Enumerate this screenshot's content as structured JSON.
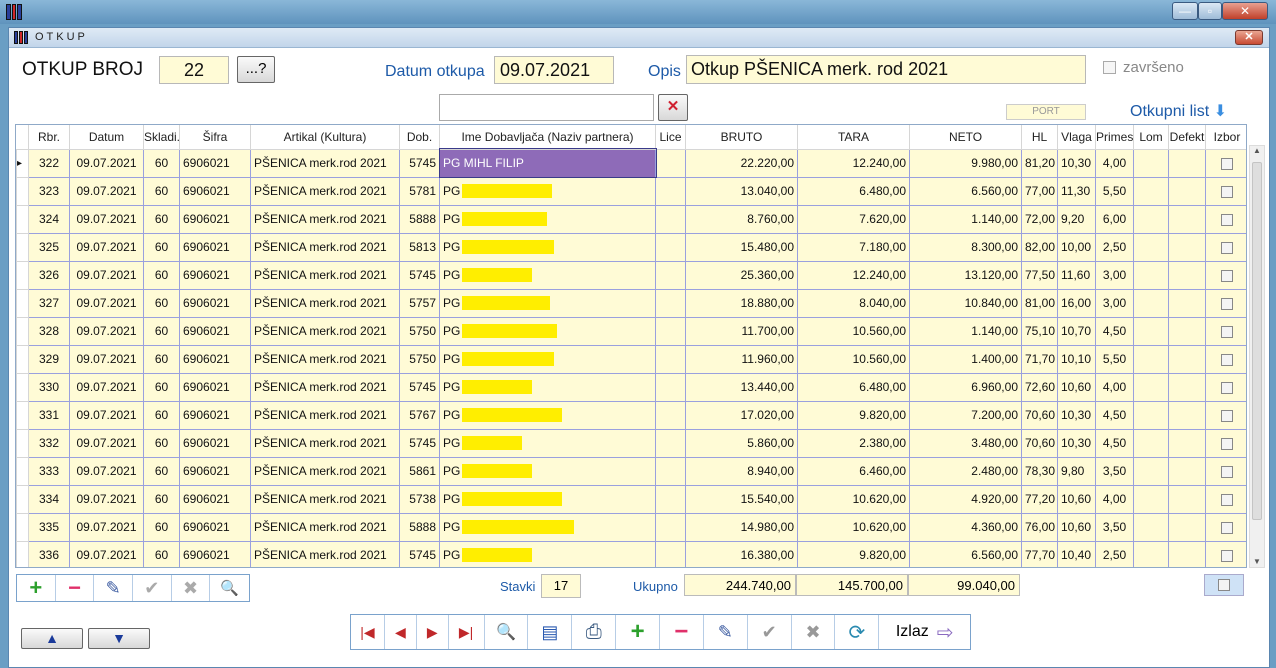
{
  "window": {
    "minimize": "—",
    "restore": "▫",
    "close": "✕"
  },
  "form": {
    "title": "OTKUP",
    "close": "✕",
    "otkup_broj_label": "OTKUP BROJ",
    "otkup_broj": "22",
    "browse_label": "...?",
    "datum_label": "Datum otkupa",
    "datum": "09.07.2021",
    "opis_label": "Opis",
    "opis": "Otkup PŠENICA merk. rod 2021",
    "zavrseno_label": "završeno",
    "port_label": "PORT",
    "otkupni_list_label": "Otkupni list",
    "search_value": "",
    "clear_icon": "✕"
  },
  "grid": {
    "columns": [
      "Rbr.",
      "Datum",
      "Skladi.",
      "Šifra",
      "Artikal (Kultura)",
      "Dob.",
      "Ime Dobavljača (Naziv partnera)",
      "Lice",
      "BRUTO",
      "TARA",
      "NETO",
      "HL",
      "Vlaga",
      "Primes",
      "Lom",
      "Defekt",
      "Izbor"
    ],
    "rows": [
      {
        "rbr": "322",
        "datum": "09.07.2021",
        "skl": "60",
        "sifra": "6906021",
        "artikal": "PŠENICA merk.rod 2021",
        "dob": "5745",
        "ime": "PG MIHL FILIP",
        "bruto": "22.220,00",
        "tara": "12.240,00",
        "neto": "9.980,00",
        "hl": "81,20",
        "vlaga": "10,30",
        "primes": "4,00"
      },
      {
        "rbr": "323",
        "datum": "09.07.2021",
        "skl": "60",
        "sifra": "6906021",
        "artikal": "PŠENICA merk.rod 2021",
        "dob": "5781",
        "ime": "PG",
        "bruto": "13.040,00",
        "tara": "6.480,00",
        "neto": "6.560,00",
        "hl": "77,00",
        "vlaga": "11,30",
        "primes": "5,50"
      },
      {
        "rbr": "324",
        "datum": "09.07.2021",
        "skl": "60",
        "sifra": "6906021",
        "artikal": "PŠENICA merk.rod 2021",
        "dob": "5888",
        "ime": "PG",
        "bruto": "8.760,00",
        "tara": "7.620,00",
        "neto": "1.140,00",
        "hl": "72,00",
        "vlaga": "9,20",
        "primes": "6,00"
      },
      {
        "rbr": "325",
        "datum": "09.07.2021",
        "skl": "60",
        "sifra": "6906021",
        "artikal": "PŠENICA merk.rod 2021",
        "dob": "5813",
        "ime": "PG",
        "bruto": "15.480,00",
        "tara": "7.180,00",
        "neto": "8.300,00",
        "hl": "82,00",
        "vlaga": "10,00",
        "primes": "2,50"
      },
      {
        "rbr": "326",
        "datum": "09.07.2021",
        "skl": "60",
        "sifra": "6906021",
        "artikal": "PŠENICA merk.rod 2021",
        "dob": "5745",
        "ime": "PG",
        "bruto": "25.360,00",
        "tara": "12.240,00",
        "neto": "13.120,00",
        "hl": "77,50",
        "vlaga": "11,60",
        "primes": "3,00"
      },
      {
        "rbr": "327",
        "datum": "09.07.2021",
        "skl": "60",
        "sifra": "6906021",
        "artikal": "PŠENICA merk.rod 2021",
        "dob": "5757",
        "ime": "PG",
        "bruto": "18.880,00",
        "tara": "8.040,00",
        "neto": "10.840,00",
        "hl": "81,00",
        "vlaga": "16,00",
        "primes": "3,00"
      },
      {
        "rbr": "328",
        "datum": "09.07.2021",
        "skl": "60",
        "sifra": "6906021",
        "artikal": "PŠENICA merk.rod 2021",
        "dob": "5750",
        "ime": "PG",
        "bruto": "11.700,00",
        "tara": "10.560,00",
        "neto": "1.140,00",
        "hl": "75,10",
        "vlaga": "10,70",
        "primes": "4,50"
      },
      {
        "rbr": "329",
        "datum": "09.07.2021",
        "skl": "60",
        "sifra": "6906021",
        "artikal": "PŠENICA merk.rod 2021",
        "dob": "5750",
        "ime": "PG",
        "bruto": "11.960,00",
        "tara": "10.560,00",
        "neto": "1.400,00",
        "hl": "71,70",
        "vlaga": "10,10",
        "primes": "5,50"
      },
      {
        "rbr": "330",
        "datum": "09.07.2021",
        "skl": "60",
        "sifra": "6906021",
        "artikal": "PŠENICA merk.rod 2021",
        "dob": "5745",
        "ime": "PG",
        "bruto": "13.440,00",
        "tara": "6.480,00",
        "neto": "6.960,00",
        "hl": "72,60",
        "vlaga": "10,60",
        "primes": "4,00"
      },
      {
        "rbr": "331",
        "datum": "09.07.2021",
        "skl": "60",
        "sifra": "6906021",
        "artikal": "PŠENICA merk.rod 2021",
        "dob": "5767",
        "ime": "PG",
        "bruto": "17.020,00",
        "tara": "9.820,00",
        "neto": "7.200,00",
        "hl": "70,60",
        "vlaga": "10,30",
        "primes": "4,50"
      },
      {
        "rbr": "332",
        "datum": "09.07.2021",
        "skl": "60",
        "sifra": "6906021",
        "artikal": "PŠENICA merk.rod 2021",
        "dob": "5745",
        "ime": "PG",
        "bruto": "5.860,00",
        "tara": "2.380,00",
        "neto": "3.480,00",
        "hl": "70,60",
        "vlaga": "10,30",
        "primes": "4,50"
      },
      {
        "rbr": "333",
        "datum": "09.07.2021",
        "skl": "60",
        "sifra": "6906021",
        "artikal": "PŠENICA merk.rod 2021",
        "dob": "5861",
        "ime": "PG",
        "bruto": "8.940,00",
        "tara": "6.460,00",
        "neto": "2.480,00",
        "hl": "78,30",
        "vlaga": "9,80",
        "primes": "3,50"
      },
      {
        "rbr": "334",
        "datum": "09.07.2021",
        "skl": "60",
        "sifra": "6906021",
        "artikal": "PŠENICA merk.rod 2021",
        "dob": "5738",
        "ime": "PG",
        "bruto": "15.540,00",
        "tara": "10.620,00",
        "neto": "4.920,00",
        "hl": "77,20",
        "vlaga": "10,60",
        "primes": "4,00"
      },
      {
        "rbr": "335",
        "datum": "09.07.2021",
        "skl": "60",
        "sifra": "6906021",
        "artikal": "PŠENICA merk.rod 2021",
        "dob": "5888",
        "ime": "PG",
        "bruto": "14.980,00",
        "tara": "10.620,00",
        "neto": "4.360,00",
        "hl": "76,00",
        "vlaga": "10,60",
        "primes": "3,50"
      },
      {
        "rbr": "336",
        "datum": "09.07.2021",
        "skl": "60",
        "sifra": "6906021",
        "artikal": "PŠENICA merk.rod 2021",
        "dob": "5745",
        "ime": "PG",
        "bruto": "16.380,00",
        "tara": "9.820,00",
        "neto": "6.560,00",
        "hl": "77,70",
        "vlaga": "10,40",
        "primes": "2,50"
      }
    ]
  },
  "footer": {
    "stavki_label": "Stavki",
    "stavki": "17",
    "ukupno_label": "Ukupno",
    "bruto": "244.740,00",
    "tara": "145.700,00",
    "neto": "99.040,00",
    "izlaz_label": "Izlaz"
  },
  "icons": {
    "first": "|◀",
    "prev": "◀",
    "next": "▶",
    "last": "▶|",
    "add": "+",
    "remove": "−",
    "edit": "✎",
    "ok": "✔",
    "cancel": "✖",
    "search": "🔍",
    "refresh": "⟳",
    "print": "⎙",
    "card": "▤",
    "up": "▲",
    "down": "▼",
    "exit": "⇨",
    "scroll_up": "▲",
    "scroll_down": "▼",
    "otkupni_list": "⬇"
  },
  "colors": {
    "field_bg": "#fffbd6",
    "label_blue": "#1d5aa8",
    "selected": "#8e6bb8",
    "add": "#2ca02c",
    "remove": "#e0306a",
    "nav": "#c0282a"
  }
}
